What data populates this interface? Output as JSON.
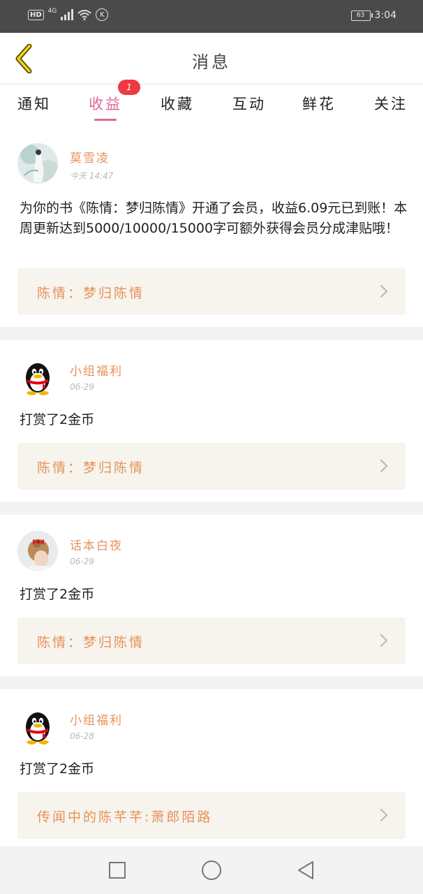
{
  "status_bar": {
    "hd": "HD",
    "network": "4G",
    "battery": "63",
    "time": "3:04"
  },
  "header": {
    "title": "消息"
  },
  "tabs": [
    {
      "label": "通知"
    },
    {
      "label": "收益",
      "active": true,
      "badge": "1"
    },
    {
      "label": "收藏"
    },
    {
      "label": "互动"
    },
    {
      "label": "鲜花"
    },
    {
      "label": "关注"
    }
  ],
  "messages": [
    {
      "sender": "莫雪凌",
      "time": "今天 14:47",
      "text": "为你的书《陈情：梦归陈情》开通了会员，收益6.09元已到账！本周更新达到5000/10000/15000字可额外获得会员分成津贴哦！",
      "book": "陈情：梦归陈情",
      "avatar": "illustration-avatar"
    },
    {
      "sender": "小组福利",
      "time": "06-29",
      "text": "打赏了2金币",
      "book": "陈情：梦归陈情",
      "avatar": "qq-penguin-avatar"
    },
    {
      "sender": "话本白夜",
      "time": "06-29",
      "text": "打赏了2金币",
      "book": "陈情：梦归陈情",
      "avatar": "girl-photo-avatar"
    },
    {
      "sender": "小组福利",
      "time": "06-28",
      "text": "打赏了2金币",
      "book": "传闻中的陈芊芊:萧郎陌路",
      "avatar": "qq-penguin-avatar"
    }
  ],
  "colors": {
    "accent_pink": "#e0679a",
    "sender_orange": "#e8915a",
    "badge_red": "#ee3a44"
  }
}
